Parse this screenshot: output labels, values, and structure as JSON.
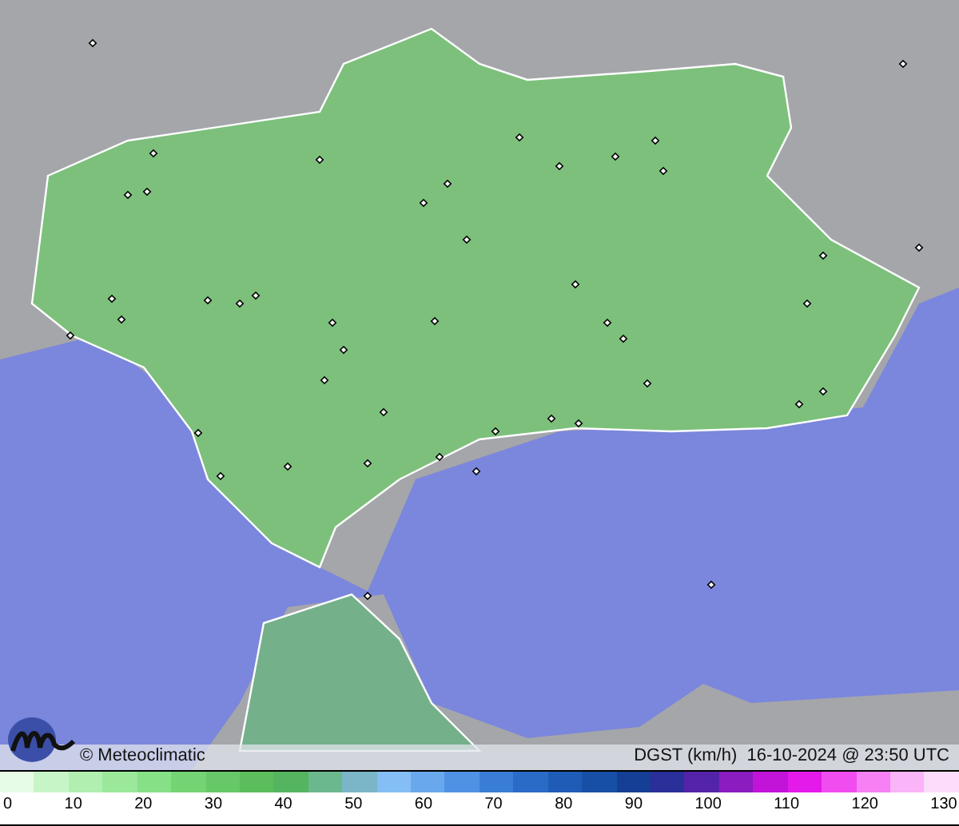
{
  "map": {
    "credit": "© Meteoclimatic",
    "caption": "DGST (km/h)  16-10-2024 @ 23:50 UTC"
  },
  "legend": {
    "labels": [
      "0",
      "10",
      "20",
      "30",
      "40",
      "50",
      "60",
      "70",
      "80",
      "90",
      "100",
      "110",
      "120",
      "130"
    ]
  }
}
